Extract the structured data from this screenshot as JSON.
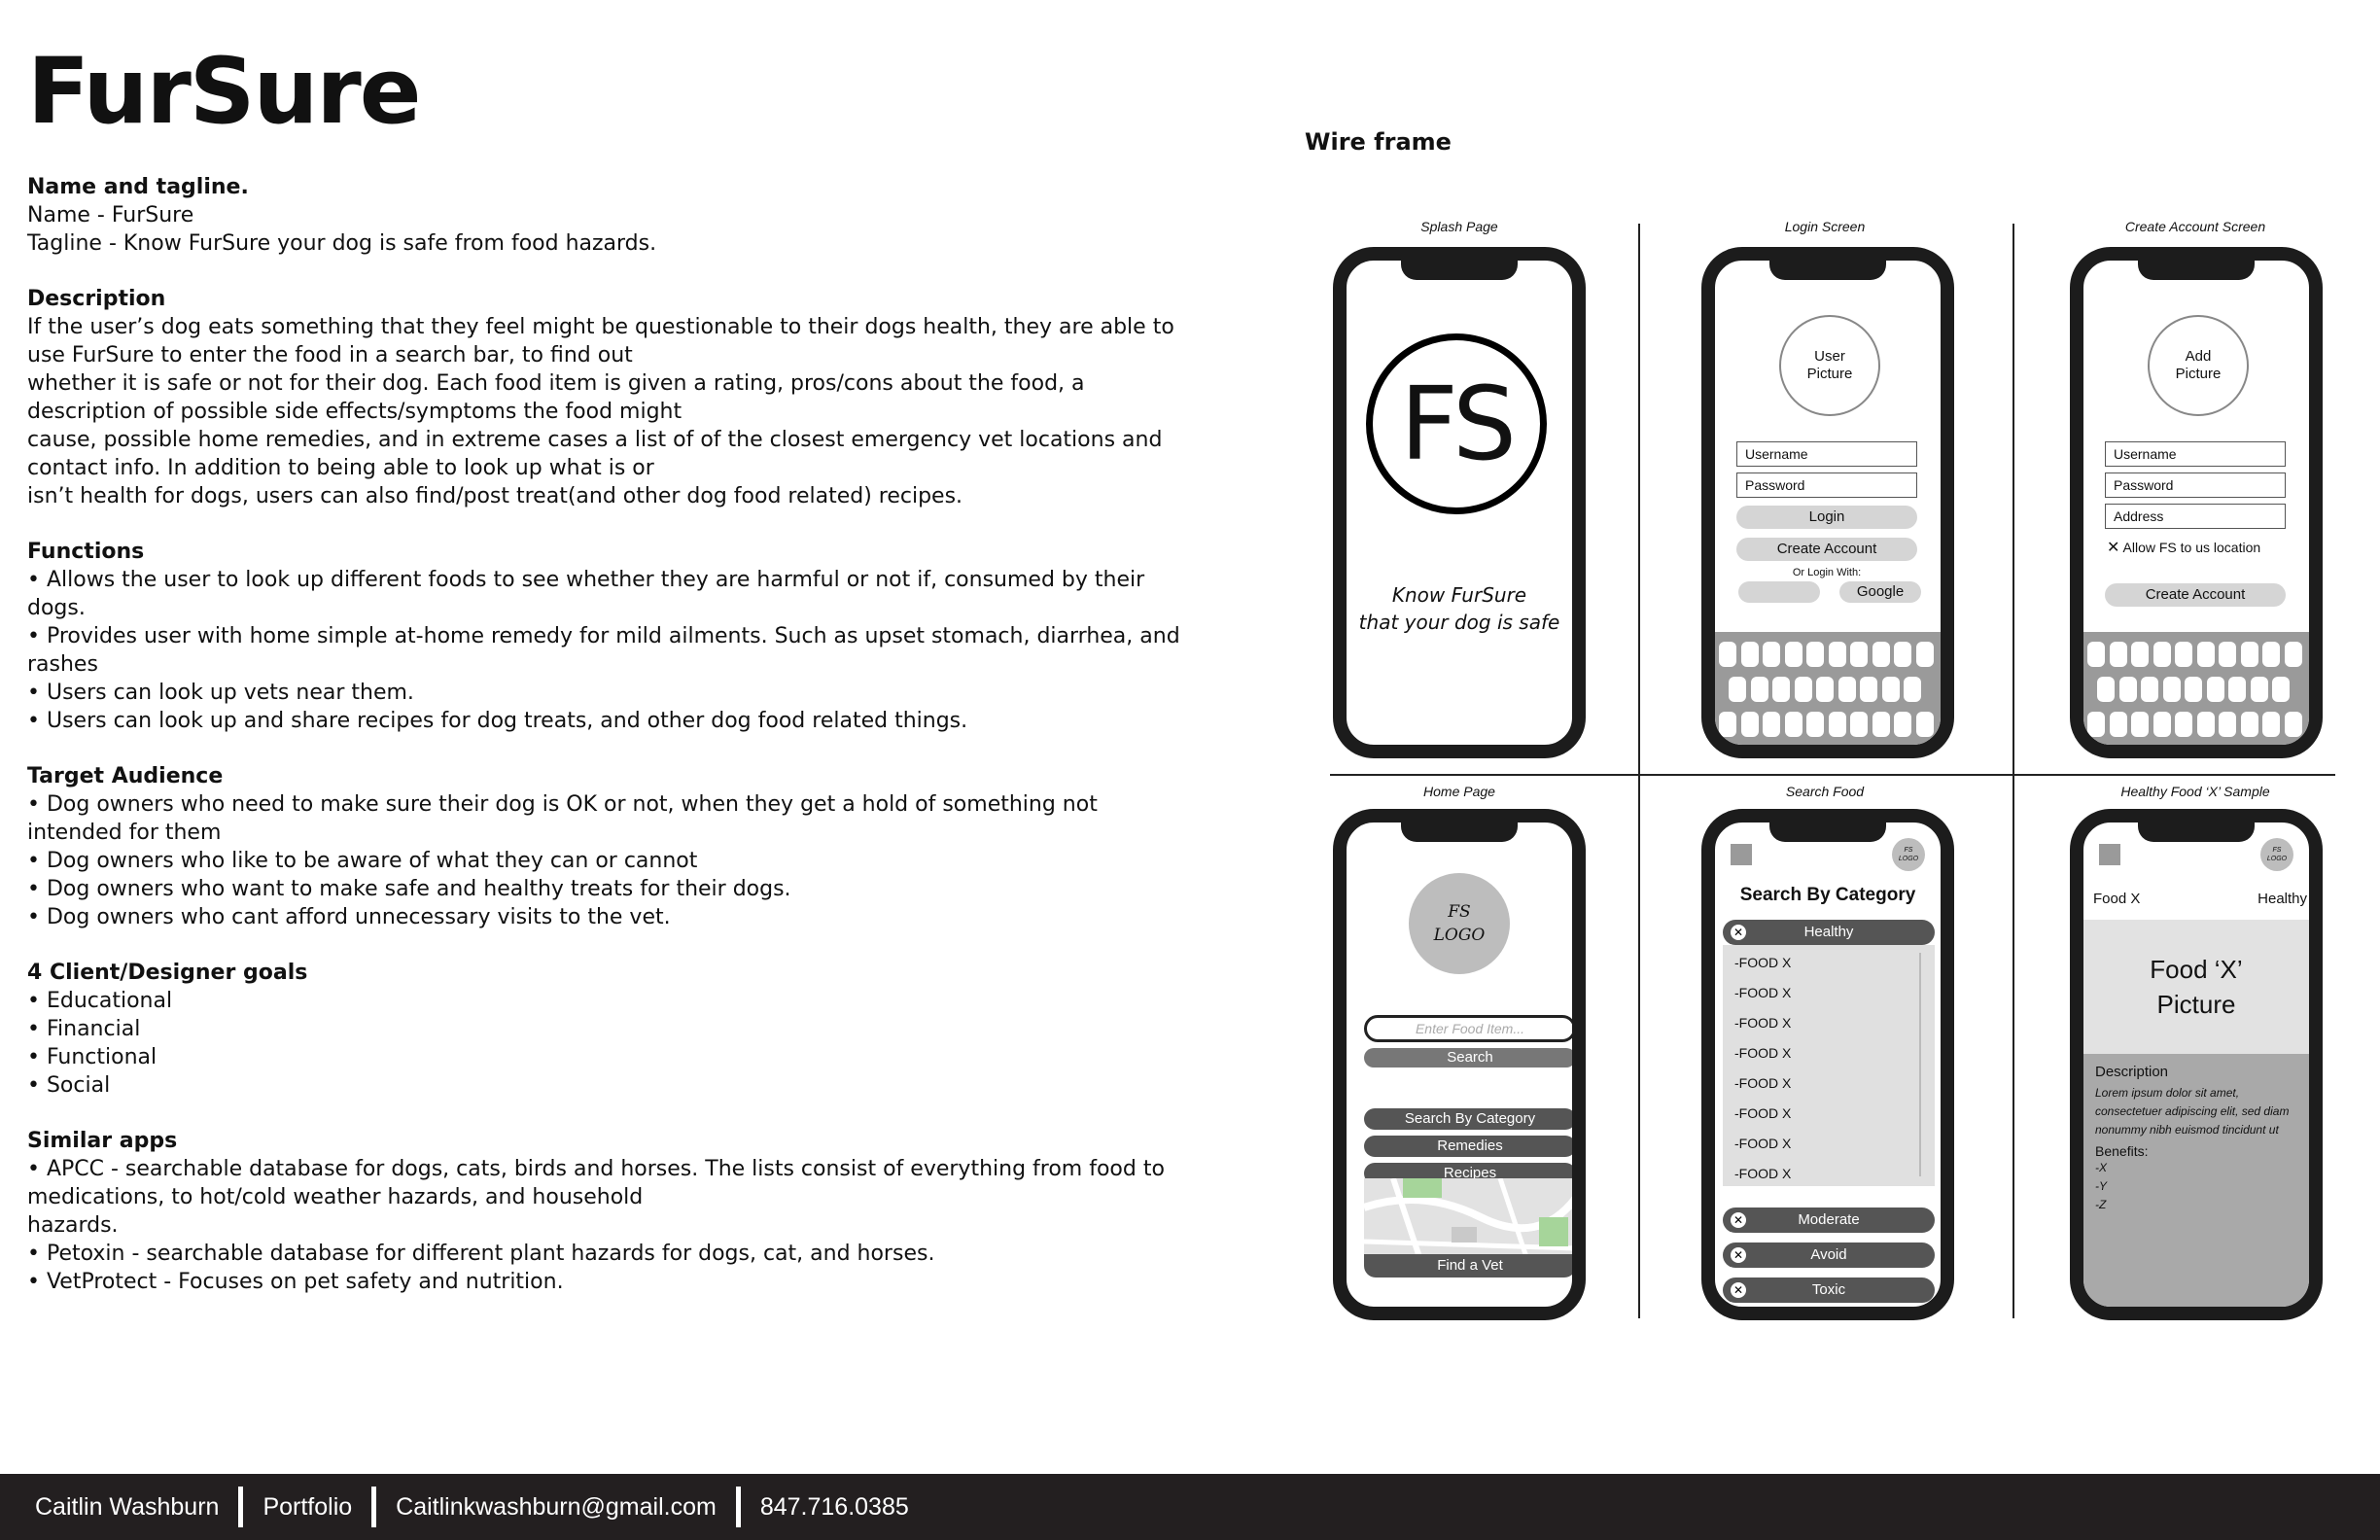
{
  "brief": {
    "title": "FurSure",
    "sections": [
      {
        "heading": "Name and tagline.",
        "lines": [
          "Name - FurSure",
          "Tagline - Know FurSure your dog is safe from food hazards."
        ]
      },
      {
        "heading": "Description",
        "lines": [
          "If the user’s dog eats something that they feel might be questionable to their dogs health, they are able to use FurSure to enter the food in a search bar, to find out",
          "whether it is safe or not for their dog. Each food item is given a rating, pros/cons about the food, a description of possible side effects/symptoms the food might",
          "cause, possible home remedies, and in extreme cases a list of of the closest emergency vet locations and contact info. In addition to being able to look up what is or",
          "isn’t health for dogs, users can also find/post treat(and other dog food related) recipes."
        ]
      },
      {
        "heading": "Functions",
        "lines": [
          "• Allows the user to look up different foods to see whether they are harmful or not if, consumed by their dogs.",
          "• Provides user with home simple at-home remedy for mild ailments. Such as upset stomach, diarrhea, and rashes",
          "• Users can look up vets near them.",
          "• Users can look up and share recipes for dog treats, and other dog food related things."
        ]
      },
      {
        "heading": "Target Audience",
        "lines": [
          "• Dog owners who need to make sure their dog is OK or not, when they get a hold of something not intended for them",
          "• Dog owners who like to be aware of what they can or cannot",
          "• Dog owners who want to make safe and healthy treats for their dogs.",
          "• Dog owners who cant afford unnecessary visits to the vet."
        ]
      },
      {
        "heading": "4 Client/Designer goals",
        "lines": [
          "• Educational",
          "• Financial",
          "• Functional",
          "• Social"
        ]
      },
      {
        "heading": "Similar apps",
        "lines": [
          "• APCC - searchable database for dogs, cats, birds and horses. The lists consist of everything from food to medications, to hot/cold weather hazards, and household",
          "hazards.",
          "• Petoxin - searchable database for different plant hazards for dogs, cat, and horses.",
          "• VetProtect - Focuses on pet safety and nutrition."
        ]
      }
    ]
  },
  "wireframe": {
    "title": "Wire frame",
    "captions": {
      "splash": "Splash Page",
      "login": "Login Screen",
      "create": "Create Account Screen",
      "home": "Home Page",
      "search": "Search Food",
      "sample": "Healthy Food ‘X’ Sample"
    },
    "splash": {
      "logo": "FS",
      "tag1": "Know FurSure",
      "tag2": "that your dog is safe"
    },
    "login": {
      "picture1": "User",
      "picture2": "Picture",
      "username": "Username",
      "password": "Password",
      "login": "Login",
      "create": "Create Account",
      "or": "Or Login With:",
      "google": "Google"
    },
    "create": {
      "picture1": "Add",
      "picture2": "Picture",
      "username": "Username",
      "password": "Password",
      "address": "Address",
      "allow": "Allow FS to us location",
      "create": "Create Account"
    },
    "home": {
      "logo1": "FS",
      "logo2": "LOGO",
      "placeholder": "Enter Food Item...",
      "search": "Search",
      "category": "Search By Category",
      "remedies": "Remedies",
      "recipes": "Recipes",
      "vet": "Find a Vet"
    },
    "search": {
      "mini1": "FS",
      "mini2": "LOGO",
      "heading": "Search By Category",
      "healthy": "Healthy",
      "food": "-FOOD X",
      "moderate": "Moderate",
      "avoid": "Avoid",
      "toxic": "Toxic"
    },
    "sample": {
      "mini1": "FS",
      "mini2": "LOGO",
      "food": "Food X",
      "rating": "Healthy",
      "pic1": "Food ‘X’",
      "pic2": "Picture",
      "desc_head": "Description",
      "desc": "Lorem ipsum dolor sit amet, consectetuer adipiscing elit, sed diam nonummy nibh euismod tincidunt ut",
      "benefits": "Benefits:",
      "b1": "-X",
      "b2": "-Y",
      "b3": "-Z"
    }
  },
  "footer": {
    "name": "Caitlin Washburn",
    "portfolio": "Portfolio",
    "email": "Caitlinkwashburn@gmail.com",
    "phone": "847.716.0385"
  }
}
